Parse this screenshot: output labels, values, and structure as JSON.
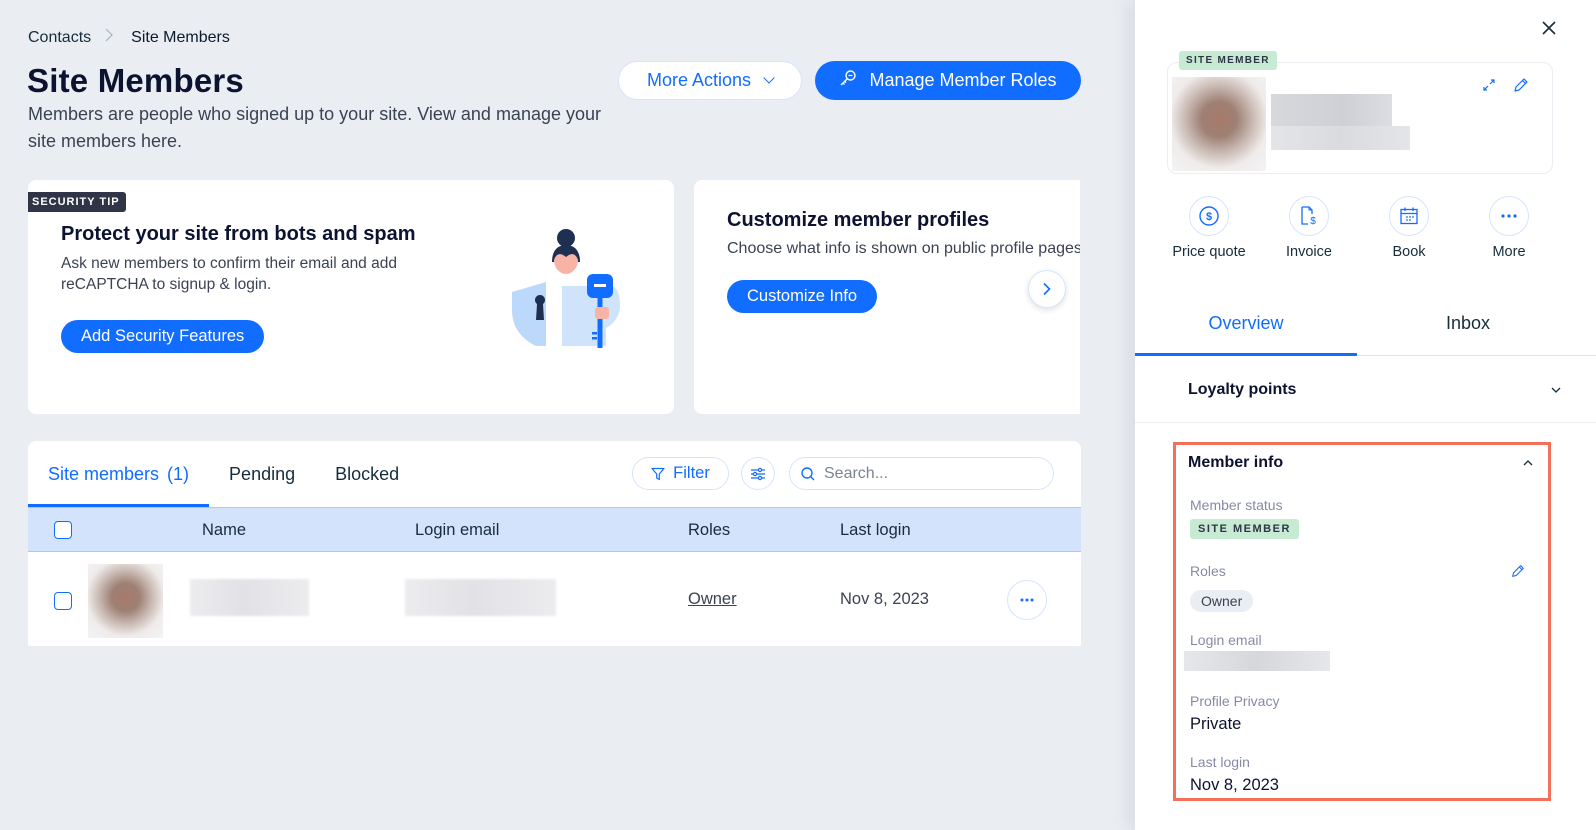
{
  "breadcrumb": {
    "items": [
      "Contacts",
      "Site Members"
    ]
  },
  "header": {
    "title": "Site Members",
    "subtitle": "Members are people who signed up to your site. View and manage your site members here.",
    "more_actions_label": "More Actions",
    "manage_roles_label": "Manage Member Roles"
  },
  "colors": {
    "accent": "#116dff",
    "highlight": "#f3705b",
    "status_green": "#c7ead3",
    "background": "#eaedf2"
  },
  "security_card": {
    "badge": "SECURITY TIP",
    "title": "Protect your site from bots and spam",
    "description": "Ask new members to confirm their email and add reCAPTCHA to signup & login.",
    "cta_label": "Add Security Features"
  },
  "customize_card": {
    "title": "Customize member profiles",
    "description": "Choose what info is shown on public profile pages",
    "cta_label": "Customize Info"
  },
  "members_table": {
    "tabs": [
      {
        "label": "Site members",
        "count": "(1)",
        "active": true
      },
      {
        "label": "Pending"
      },
      {
        "label": "Blocked"
      }
    ],
    "filter_label": "Filter",
    "search_placeholder": "Search...",
    "columns": [
      "Name",
      "Login email",
      "Roles",
      "Last login"
    ],
    "rows": [
      {
        "name": "",
        "email": "",
        "role": "Owner",
        "last_login": "Nov 8, 2023"
      }
    ]
  },
  "panel": {
    "status_tag": "SITE MEMBER",
    "quick_actions": [
      {
        "label": "Price quote",
        "icon": "dollar-icon"
      },
      {
        "label": "Invoice",
        "icon": "invoice-icon"
      },
      {
        "label": "Book",
        "icon": "calendar-icon"
      },
      {
        "label": "More",
        "icon": "more-icon"
      }
    ],
    "tabs": [
      {
        "label": "Overview",
        "active": true
      },
      {
        "label": "Inbox"
      }
    ],
    "loyalty_title": "Loyalty points",
    "member_info": {
      "title": "Member info",
      "status_label": "Member status",
      "status_value": "SITE MEMBER",
      "roles_label": "Roles",
      "roles_value": "Owner",
      "email_label": "Login email",
      "privacy_label": "Profile Privacy",
      "privacy_value": "Private",
      "last_login_label": "Last login",
      "last_login_value": "Nov 8, 2023"
    }
  }
}
